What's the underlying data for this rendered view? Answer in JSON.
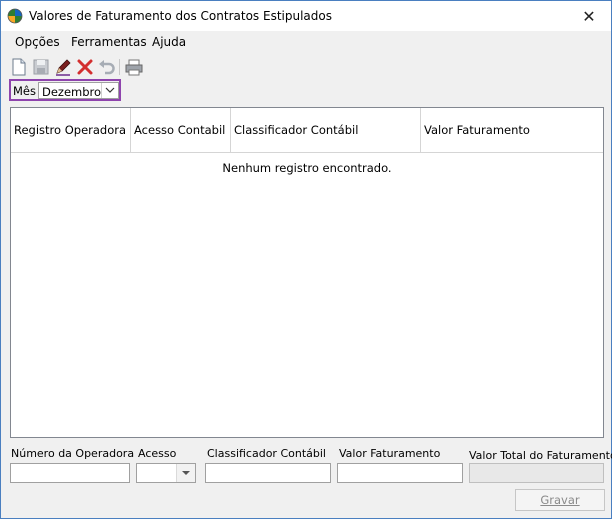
{
  "window": {
    "title": "Valores de Faturamento dos Contratos Estipulados",
    "close_symbol": "✕"
  },
  "menu": {
    "items": [
      {
        "label": "Opções"
      },
      {
        "label": "Ferramentas"
      },
      {
        "label": "Ajuda"
      }
    ]
  },
  "toolbar": {
    "buttons": [
      {
        "icon": "new-document-icon"
      },
      {
        "icon": "save-disk-icon"
      },
      {
        "icon": "edit-pencil-icon"
      },
      {
        "icon": "delete-x-icon"
      },
      {
        "icon": "undo-icon"
      },
      {
        "icon": "print-icon"
      }
    ]
  },
  "filter": {
    "month_label": "Mês",
    "month_value": "Dezembro"
  },
  "grid": {
    "columns": [
      "Registro Operadora",
      "Acesso Contabil",
      "Classificador Contábil",
      "Valor Faturamento"
    ],
    "empty_message": "Nenhum registro encontrado."
  },
  "form": {
    "operator_number_label": "Número da Operadora",
    "operator_number_value": "",
    "access_label": "Acesso",
    "access_value": "",
    "classifier_label": "Classificador Contábil",
    "classifier_value": "",
    "billing_value_label": "Valor Faturamento",
    "billing_value_value": "",
    "total_label": "Valor Total do Faturamento",
    "total_value": "",
    "save_label": "Gravar"
  },
  "colors": {
    "highlight_border": "#8e44ad",
    "window_border": "#4a7fc0",
    "delete_red": "#d32f2f"
  }
}
